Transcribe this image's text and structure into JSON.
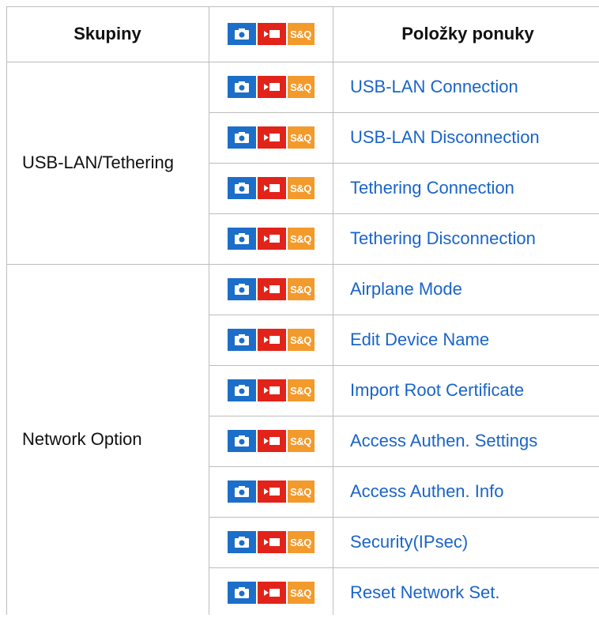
{
  "table": {
    "headers": {
      "group": "Skupiny",
      "modes_icons": [
        "camera-still-icon",
        "camera-movie-icon",
        "slow-quick-icon"
      ],
      "items": "Položky ponuky"
    },
    "icon_labels": {
      "sq": "S&Q"
    },
    "colors": {
      "camera": "#1c6ec9",
      "movie": "#e2231a",
      "sq": "#f39a2c",
      "link": "#1a64c8"
    },
    "groups": [
      {
        "name": "USB-LAN/Tethering",
        "items": [
          "USB-LAN Connection",
          "USB-LAN Disconnection",
          "Tethering Connection",
          "Tethering Disconnection"
        ]
      },
      {
        "name": "Network Option",
        "items": [
          "Airplane Mode",
          "Edit Device Name",
          "Import Root Certificate",
          "Access Authen. Settings",
          "Access Authen. Info",
          "Security(IPsec)",
          "Reset Network Set."
        ]
      }
    ]
  }
}
